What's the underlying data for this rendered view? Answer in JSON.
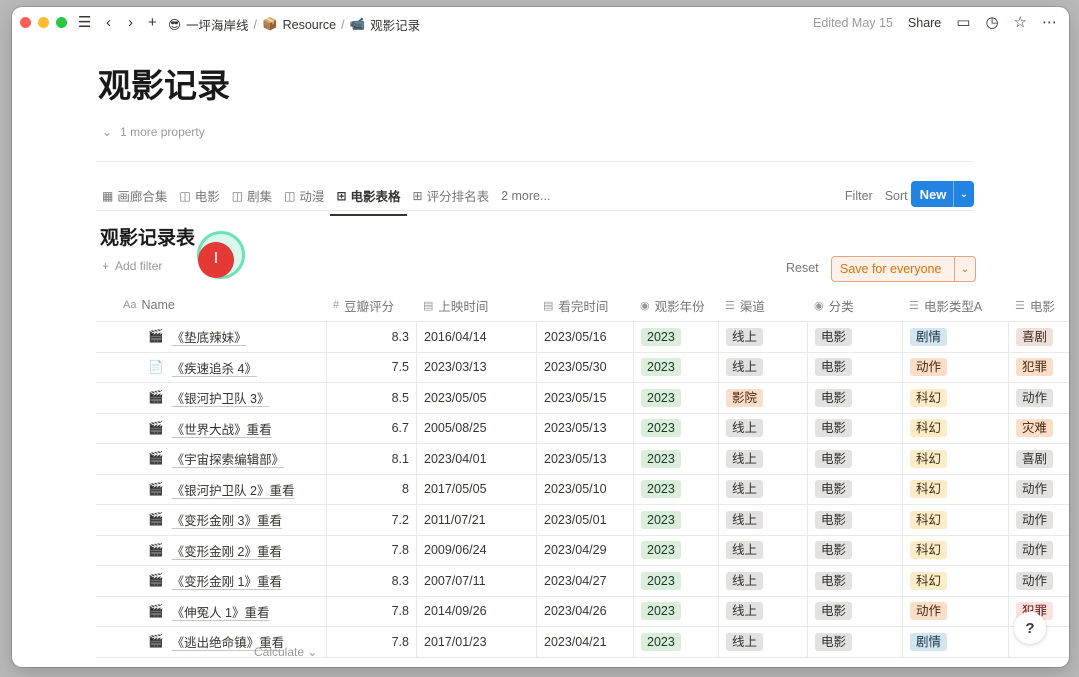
{
  "topbar": {
    "breadcrumbs": [
      {
        "icon": "sunglasses-emoji",
        "glyph": "😎",
        "label": "一坪海岸线"
      },
      {
        "icon": "box-emoji",
        "glyph": "📦",
        "label": "Resource"
      },
      {
        "icon": "film-camera-emoji",
        "glyph": "📹",
        "label": "观影记录"
      }
    ],
    "edited": "Edited May 15",
    "share": "Share"
  },
  "page": {
    "title": "观影记录",
    "more_property": "1 more property"
  },
  "views": {
    "tabs": [
      {
        "icon": "gallery-icon",
        "glyph": "▦",
        "label": "画廊合集"
      },
      {
        "icon": "board-icon",
        "glyph": "◫",
        "label": "电影"
      },
      {
        "icon": "board-icon",
        "glyph": "◫",
        "label": "剧集"
      },
      {
        "icon": "board-icon",
        "glyph": "◫",
        "label": "动漫"
      },
      {
        "icon": "table-icon",
        "glyph": "⊞",
        "label": "电影表格",
        "active": true
      },
      {
        "icon": "table-icon",
        "glyph": "⊞",
        "label": "评分排名表"
      }
    ],
    "more": "2 more..."
  },
  "toolbar": {
    "filter": "Filter",
    "sort": "Sort",
    "new": "New"
  },
  "database": {
    "title": "观影记录表",
    "add_filter": "Add filter",
    "reset": "Reset",
    "save": "Save for everyone",
    "calculate": "Calculate"
  },
  "table": {
    "columns": [
      {
        "icon": "Aa",
        "label": "Name"
      },
      {
        "icon": "#",
        "label": "豆瓣评分"
      },
      {
        "icon": "calendar-icon",
        "label": "上映时间"
      },
      {
        "icon": "calendar-icon",
        "label": "看完时间"
      },
      {
        "icon": "select-icon",
        "label": "观影年份"
      },
      {
        "icon": "list-icon",
        "label": "渠道"
      },
      {
        "icon": "select-icon",
        "label": "分类"
      },
      {
        "icon": "list-icon",
        "label": "电影类型A"
      },
      {
        "icon": "list-icon",
        "label": "电影"
      }
    ],
    "rows": [
      {
        "icon": "🎬",
        "name": "《垫底辣妹》",
        "rating": "8.3",
        "release": "2016/04/14",
        "finished": "2023/05/16",
        "year": "2023",
        "channel": "线上",
        "category": "电影",
        "genreA": "剧情",
        "genreA_color": "p-blue",
        "genreB": "喜剧",
        "genreB_color": "p-brown"
      },
      {
        "icon": "📄",
        "name": "《疾速追杀 4》",
        "rating": "7.5",
        "release": "2023/03/13",
        "finished": "2023/05/30",
        "year": "2023",
        "channel": "线上",
        "category": "电影",
        "genreA": "动作",
        "genreA_color": "p-orange",
        "genreB": "犯罪",
        "genreB_color": "p-orange"
      },
      {
        "icon": "🎬",
        "name": "《银河护卫队 3》",
        "rating": "8.5",
        "release": "2023/05/05",
        "finished": "2023/05/15",
        "year": "2023",
        "channel": "影院",
        "channel_color": "p-orange",
        "category": "电影",
        "genreA": "科幻",
        "genreA_color": "p-yellow",
        "genreB": "动作",
        "genreB_color": "p-gray"
      },
      {
        "icon": "🎬",
        "name": "《世界大战》重看",
        "rating": "6.7",
        "release": "2005/08/25",
        "finished": "2023/05/13",
        "year": "2023",
        "channel": "线上",
        "category": "电影",
        "genreA": "科幻",
        "genreA_color": "p-yellow",
        "genreB": "灾难",
        "genreB_color": "p-orange"
      },
      {
        "icon": "🎬",
        "name": "《宇宙探索编辑部》",
        "rating": "8.1",
        "release": "2023/04/01",
        "finished": "2023/05/13",
        "year": "2023",
        "channel": "线上",
        "category": "电影",
        "genreA": "科幻",
        "genreA_color": "p-yellow",
        "genreB": "喜剧",
        "genreB_color": "p-gray"
      },
      {
        "icon": "🎬",
        "name": "《银河护卫队 2》重看",
        "rating": "8",
        "release": "2017/05/05",
        "finished": "2023/05/10",
        "year": "2023",
        "channel": "线上",
        "category": "电影",
        "genreA": "科幻",
        "genreA_color": "p-yellow",
        "genreB": "动作",
        "genreB_color": "p-gray"
      },
      {
        "icon": "🎬",
        "name": "《变形金刚 3》重看",
        "rating": "7.2",
        "release": "2011/07/21",
        "finished": "2023/05/01",
        "year": "2023",
        "channel": "线上",
        "category": "电影",
        "genreA": "科幻",
        "genreA_color": "p-yellow",
        "genreB": "动作",
        "genreB_color": "p-gray"
      },
      {
        "icon": "🎬",
        "name": "《变形金刚 2》重看",
        "rating": "7.8",
        "release": "2009/06/24",
        "finished": "2023/04/29",
        "year": "2023",
        "channel": "线上",
        "category": "电影",
        "genreA": "科幻",
        "genreA_color": "p-yellow",
        "genreB": "动作",
        "genreB_color": "p-gray"
      },
      {
        "icon": "🎬",
        "name": "《变形金刚 1》重看",
        "rating": "8.3",
        "release": "2007/07/11",
        "finished": "2023/04/27",
        "year": "2023",
        "channel": "线上",
        "category": "电影",
        "genreA": "科幻",
        "genreA_color": "p-yellow",
        "genreB": "动作",
        "genreB_color": "p-gray"
      },
      {
        "icon": "🎬",
        "name": "《伸冤人 1》重看",
        "rating": "7.8",
        "release": "2014/09/26",
        "finished": "2023/04/26",
        "year": "2023",
        "channel": "线上",
        "category": "电影",
        "genreA": "动作",
        "genreA_color": "p-orange",
        "genreB": "犯罪",
        "genreB_color": "p-red"
      },
      {
        "icon": "🎬",
        "name": "《逃出绝命镇》重看",
        "rating": "7.8",
        "release": "2017/01/23",
        "finished": "2023/04/21",
        "year": "2023",
        "channel": "线上",
        "category": "电影",
        "genreA": "剧情",
        "genreA_color": "p-blue",
        "genreB": "",
        "genreB_color": "p-gray"
      }
    ]
  },
  "help": "?"
}
